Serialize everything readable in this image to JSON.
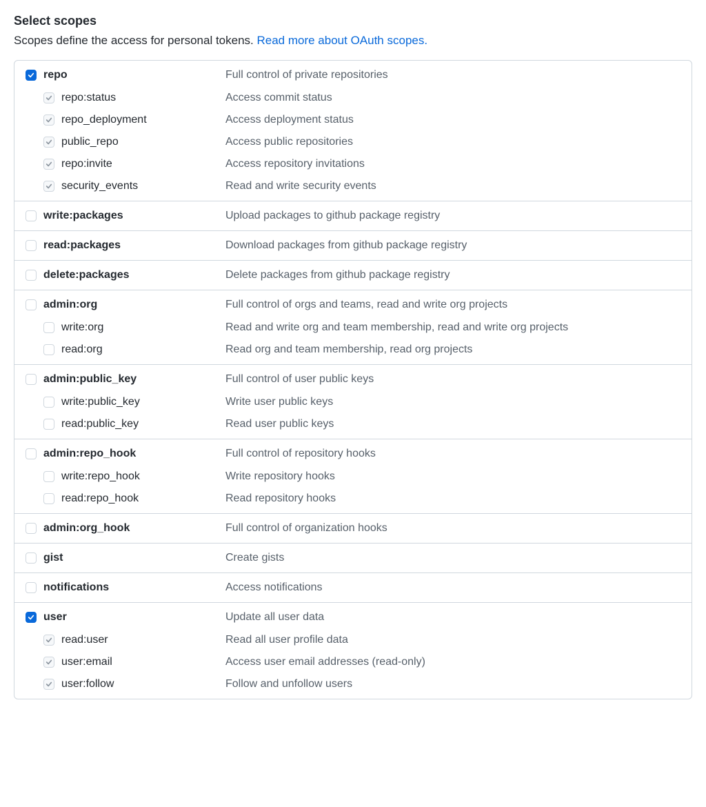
{
  "header": {
    "title": "Select scopes",
    "subtitle": "Scopes define the access for personal tokens. ",
    "link_text": "Read more about OAuth scopes."
  },
  "groups": [
    {
      "top": {
        "name": "repo",
        "desc": "Full control of private repositories",
        "state": "checked"
      },
      "children": [
        {
          "name": "repo:status",
          "desc": "Access commit status",
          "state": "implied"
        },
        {
          "name": "repo_deployment",
          "desc": "Access deployment status",
          "state": "implied"
        },
        {
          "name": "public_repo",
          "desc": "Access public repositories",
          "state": "implied"
        },
        {
          "name": "repo:invite",
          "desc": "Access repository invitations",
          "state": "implied"
        },
        {
          "name": "security_events",
          "desc": "Read and write security events",
          "state": "implied"
        }
      ]
    },
    {
      "top": {
        "name": "write:packages",
        "desc": "Upload packages to github package registry",
        "state": "unchecked"
      },
      "children": []
    },
    {
      "top": {
        "name": "read:packages",
        "desc": "Download packages from github package registry",
        "state": "unchecked"
      },
      "children": []
    },
    {
      "top": {
        "name": "delete:packages",
        "desc": "Delete packages from github package registry",
        "state": "unchecked"
      },
      "children": []
    },
    {
      "top": {
        "name": "admin:org",
        "desc": "Full control of orgs and teams, read and write org projects",
        "state": "unchecked"
      },
      "children": [
        {
          "name": "write:org",
          "desc": "Read and write org and team membership, read and write org projects",
          "state": "unchecked"
        },
        {
          "name": "read:org",
          "desc": "Read org and team membership, read org projects",
          "state": "unchecked"
        }
      ]
    },
    {
      "top": {
        "name": "admin:public_key",
        "desc": "Full control of user public keys",
        "state": "unchecked"
      },
      "children": [
        {
          "name": "write:public_key",
          "desc": "Write user public keys",
          "state": "unchecked"
        },
        {
          "name": "read:public_key",
          "desc": "Read user public keys",
          "state": "unchecked"
        }
      ]
    },
    {
      "top": {
        "name": "admin:repo_hook",
        "desc": "Full control of repository hooks",
        "state": "unchecked"
      },
      "children": [
        {
          "name": "write:repo_hook",
          "desc": "Write repository hooks",
          "state": "unchecked"
        },
        {
          "name": "read:repo_hook",
          "desc": "Read repository hooks",
          "state": "unchecked"
        }
      ]
    },
    {
      "top": {
        "name": "admin:org_hook",
        "desc": "Full control of organization hooks",
        "state": "unchecked"
      },
      "children": []
    },
    {
      "top": {
        "name": "gist",
        "desc": "Create gists",
        "state": "unchecked"
      },
      "children": []
    },
    {
      "top": {
        "name": "notifications",
        "desc": "Access notifications",
        "state": "unchecked"
      },
      "children": []
    },
    {
      "top": {
        "name": "user",
        "desc": "Update all user data",
        "state": "checked"
      },
      "children": [
        {
          "name": "read:user",
          "desc": "Read all user profile data",
          "state": "implied"
        },
        {
          "name": "user:email",
          "desc": "Access user email addresses (read-only)",
          "state": "implied"
        },
        {
          "name": "user:follow",
          "desc": "Follow and unfollow users",
          "state": "implied"
        }
      ]
    }
  ]
}
